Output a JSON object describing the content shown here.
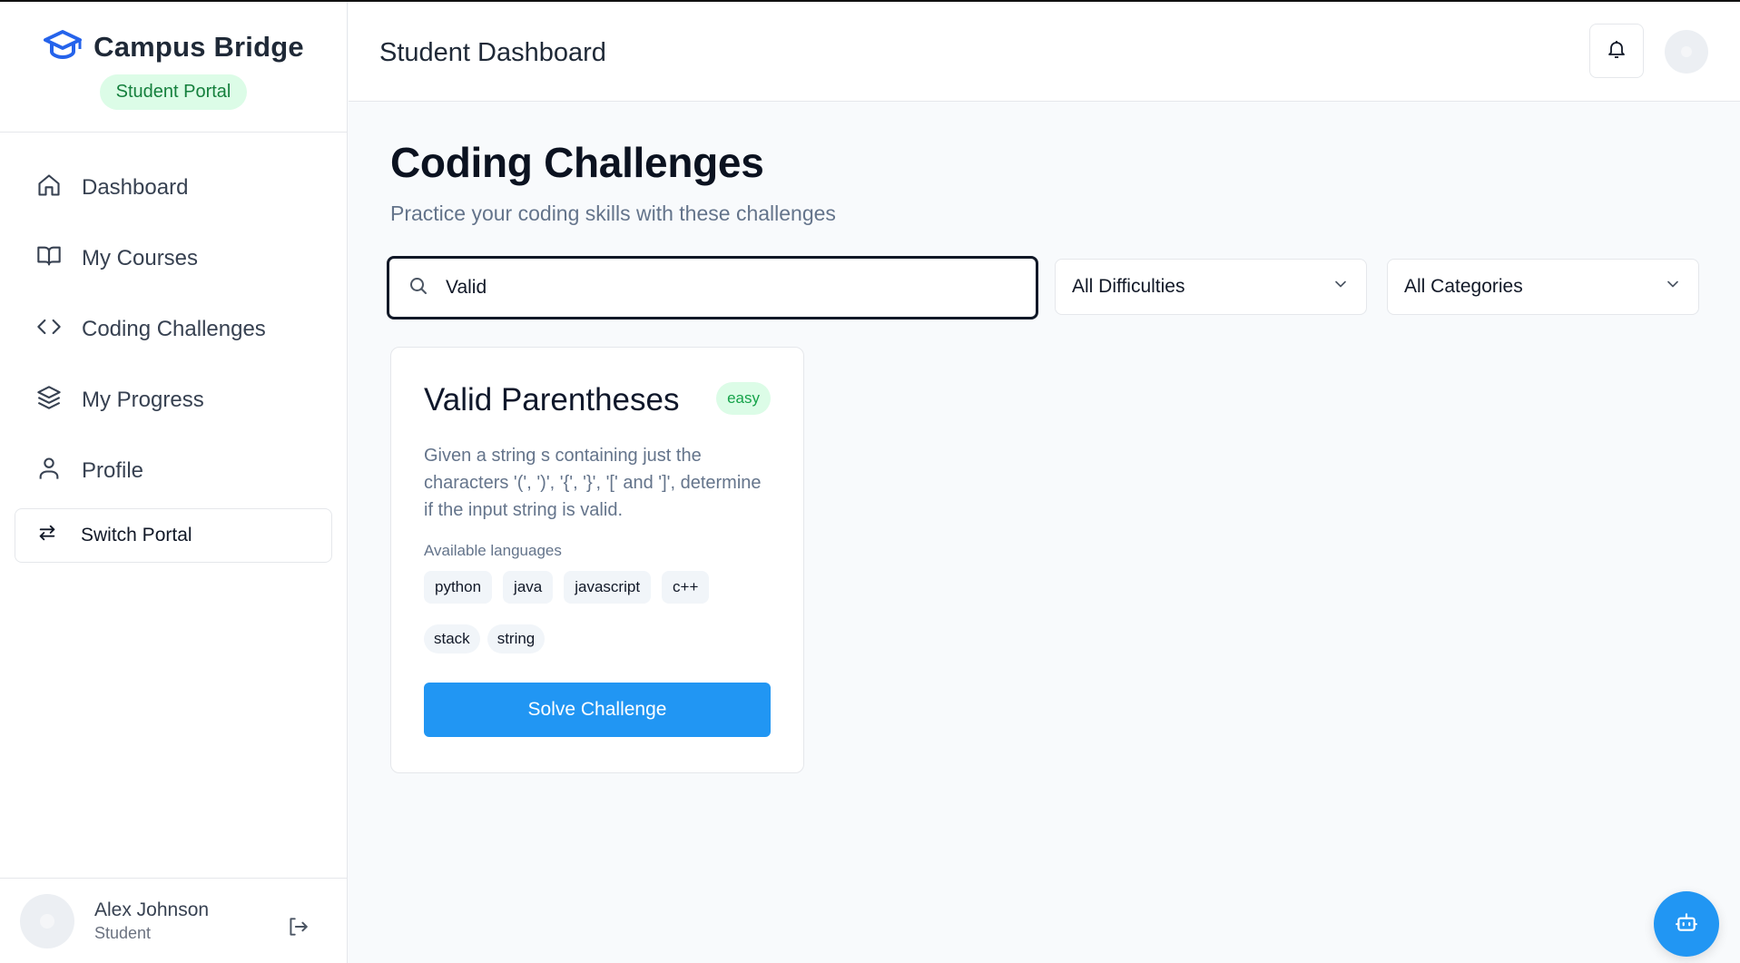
{
  "brand": {
    "name": "Campus Bridge",
    "portal_badge": "Student Portal",
    "logo_icon": "graduation-cap-icon",
    "accent": "#2563eb"
  },
  "sidebar": {
    "items": [
      {
        "label": "Dashboard",
        "icon": "home-icon"
      },
      {
        "label": "My Courses",
        "icon": "book-open-icon"
      },
      {
        "label": "Coding Challenges",
        "icon": "code-icon"
      },
      {
        "label": "My Progress",
        "icon": "layers-icon"
      },
      {
        "label": "Profile",
        "icon": "user-icon"
      }
    ],
    "switch_portal": {
      "label": "Switch Portal",
      "icon": "arrows-swap-icon"
    }
  },
  "user": {
    "name": "Alex Johnson",
    "role": "Student"
  },
  "header": {
    "title": "Student Dashboard"
  },
  "main": {
    "title": "Coding Challenges",
    "subtitle": "Practice your coding skills with these challenges",
    "search": {
      "value": "Valid"
    },
    "difficulty_select": {
      "value": "All Difficulties"
    },
    "category_select": {
      "value": "All Categories"
    }
  },
  "challenge": {
    "title": "Valid Parentheses",
    "difficulty": "easy",
    "description": "Given a string s containing just the characters '(', ')', '{', '}', '[' and ']', determine if the input string is valid.",
    "languages_label": "Available languages",
    "languages": [
      "python",
      "java",
      "javascript",
      "c++"
    ],
    "tags": [
      "stack",
      "string"
    ],
    "button": "Solve Challenge"
  },
  "colors": {
    "primary_button": "#2196f3",
    "easy_badge_bg": "#dcfce7",
    "easy_badge_text": "#16a34a"
  }
}
